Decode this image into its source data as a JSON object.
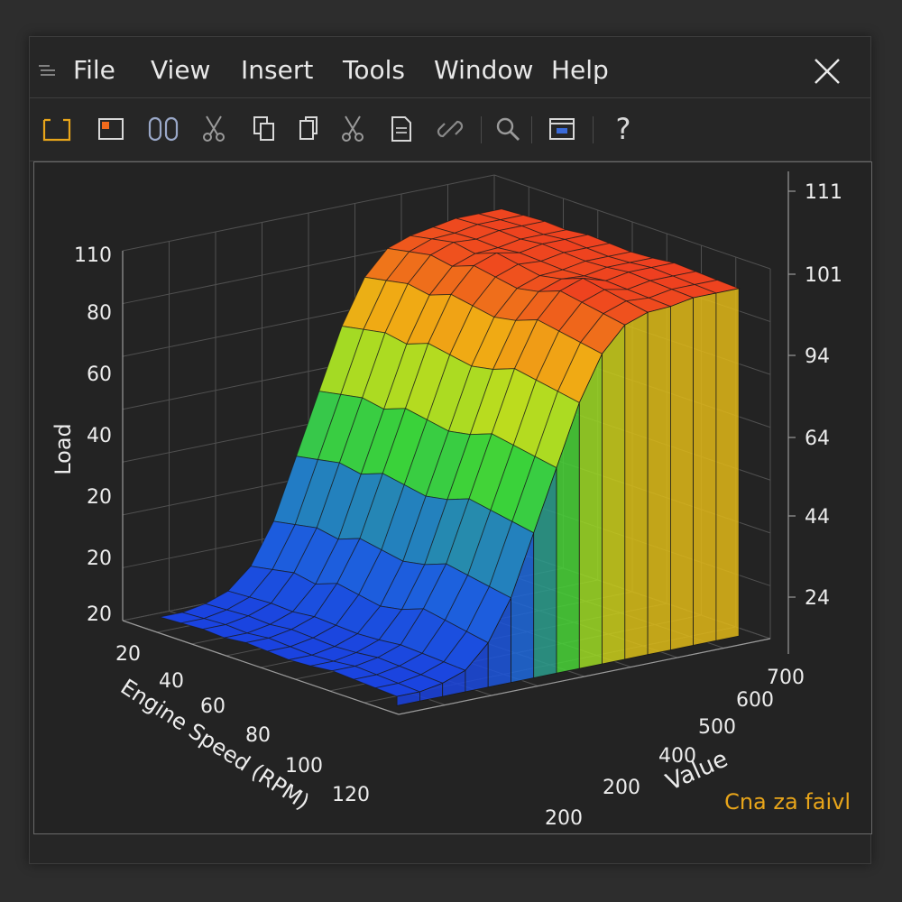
{
  "menu": {
    "items": [
      "File",
      "View",
      "Insert",
      "Tools",
      "Window",
      "Help"
    ]
  },
  "toolbar": {
    "buttons": [
      "open-folder-icon",
      "image-icon",
      "link-icon",
      "cut-icon",
      "copy-icon",
      "paste-icon",
      "cut-icon",
      "document-icon",
      "link-chain-icon",
      "search-icon",
      "panel-icon",
      "help-icon"
    ],
    "help_label": "?"
  },
  "colors": {
    "accent": "#e8a51a",
    "surface_low": "#1a3ee0",
    "surface_mid": "#3ad23a",
    "surface_high": "#ee2a22"
  },
  "chart_data": {
    "type": "surface3d",
    "z_axis_left": {
      "label": "Load",
      "ticks": [
        "110",
        "80",
        "60",
        "40",
        "20",
        "20",
        "20"
      ]
    },
    "z_axis_right": {
      "ticks": [
        "111",
        "101",
        "94",
        "64",
        "44",
        "24"
      ]
    },
    "x_axis": {
      "label": "Engine Speed (RPM)",
      "ticks": [
        "20",
        "40",
        "60",
        "80",
        "100",
        "120"
      ]
    },
    "y_axis": {
      "label": "Value",
      "ticks": [
        "700",
        "600",
        "500",
        "400",
        "200",
        "200"
      ]
    },
    "grid": true,
    "surface": {
      "rows": 12,
      "cols": 16,
      "z_range": [
        20,
        110
      ],
      "profile_by_value": [
        22,
        22,
        23,
        25,
        30,
        40,
        55,
        70,
        85,
        96,
        102,
        104,
        105,
        106,
        106,
        106
      ],
      "ridge_by_speed": [
        0,
        1,
        2,
        1,
        3,
        2,
        1,
        2,
        4,
        3,
        2,
        1
      ]
    }
  },
  "footer": {
    "text": "Cna za faivl"
  }
}
